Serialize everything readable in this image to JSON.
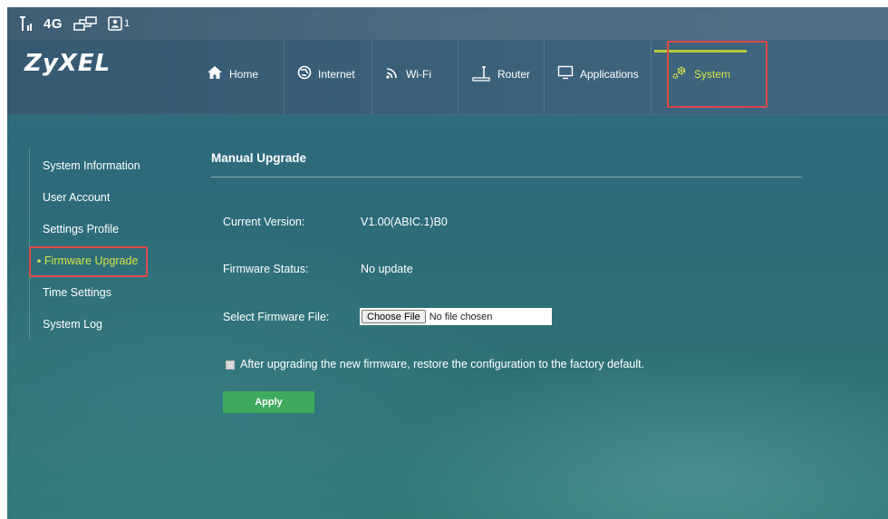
{
  "status_bar": {
    "network": "4G",
    "sim_count": "1"
  },
  "brand": {
    "logo": "ZyXEL"
  },
  "nav": {
    "items": [
      {
        "label": "Home",
        "icon": "home-icon"
      },
      {
        "label": "Internet",
        "icon": "globe-icon"
      },
      {
        "label": "Wi-Fi",
        "icon": "wifi-icon"
      },
      {
        "label": "Router",
        "icon": "router-icon"
      },
      {
        "label": "Applications",
        "icon": "monitor-icon"
      },
      {
        "label": "System",
        "icon": "gear-icon",
        "active": true
      }
    ]
  },
  "sidebar": {
    "items": [
      {
        "label": "System Information"
      },
      {
        "label": "User Account"
      },
      {
        "label": "Settings Profile"
      },
      {
        "label": "Firmware Upgrade",
        "active": true
      },
      {
        "label": "Time Settings"
      },
      {
        "label": "System Log"
      }
    ]
  },
  "main": {
    "title": "Manual Upgrade",
    "current_version_label": "Current Version:",
    "current_version_value": "V1.00(ABIC.1)B0",
    "firmware_status_label": "Firmware Status:",
    "firmware_status_value": "No update",
    "select_file_label": "Select Firmware File:",
    "choose_file_label": "Choose File",
    "no_file_text": "No file chosen",
    "restore_option_label": "After upgrading the new firmware, restore the configuration to the factory default.",
    "apply_label": "Apply"
  },
  "colors": {
    "active_accent": "#d6e14a",
    "apply_button": "#3daa5c",
    "highlight_box": "#e04848"
  }
}
